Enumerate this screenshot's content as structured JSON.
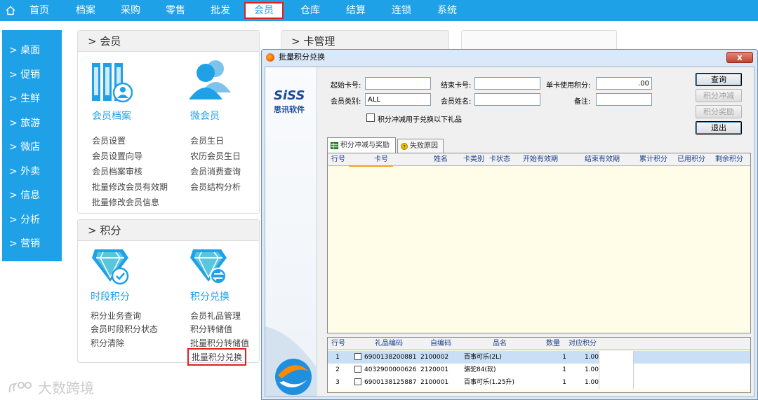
{
  "topnav": {
    "items": [
      "首页",
      "档案",
      "采购",
      "零售",
      "批发",
      "会员",
      "仓库",
      "结算",
      "连锁",
      "系统"
    ],
    "active": "会员"
  },
  "sidebar": {
    "items": [
      "> 桌面",
      "> 促销",
      "> 生鲜",
      "> 旅游",
      "> 微店",
      "> 外卖",
      "> 信息",
      "> 分析",
      "> 营销"
    ]
  },
  "panels": {
    "member": {
      "title": "> 会员",
      "card1": "会员档案",
      "card2": "微会员",
      "links_left": [
        "会员设置",
        "会员设置向导",
        "会员档案审核",
        "批量修改会员有效期",
        "批量修改会员信息"
      ],
      "links_right": [
        "会员生日",
        "农历会员生日",
        "会员消费查询",
        "会员结构分析"
      ]
    },
    "card": {
      "title": "> 卡管理"
    },
    "points": {
      "title": "> 积分",
      "card1": "时段积分",
      "card2": "积分兑换",
      "links_left": [
        "积分业务查询",
        "会员时段积分状态",
        "积分清除"
      ],
      "links_right": [
        "会员礼品管理",
        "积分转储值",
        "批量积分转储值",
        "批量积分兑换"
      ]
    }
  },
  "watermark": "大数跨境",
  "dialog": {
    "title": "批量积分兑换",
    "close": "x",
    "logo": {
      "brand": "SiSS",
      "sub": "思讯软件"
    },
    "form": {
      "start_card_label": "起始卡号:",
      "start_card_value": "",
      "end_card_label": "结束卡号:",
      "end_card_value": "",
      "single_points_label": "单卡使用积分:",
      "single_points_value": ".00",
      "member_type_label": "会员类别:",
      "member_type_value": "ALL",
      "member_name_label": "会员姓名:",
      "member_name_value": "",
      "remark_label": "备注:",
      "remark_value": "",
      "offset_checkbox_label": "积分冲减用于兑换以下礼品"
    },
    "buttons": {
      "query": "查询",
      "offset": "积分冲减",
      "reward": "积分奖励",
      "exit": "退出"
    },
    "tabs": [
      "积分冲减与奖励",
      "失败原因"
    ],
    "main_grid": {
      "headers": [
        "行号",
        "卡号",
        "姓名",
        "卡类别",
        "卡状态",
        "开始有效期",
        "结束有效期",
        "累计积分",
        "已用积分",
        "剩余积分"
      ]
    },
    "gift_grid": {
      "headers": [
        "行号",
        "礼品编码",
        "自编码",
        "品名",
        "数量",
        "对应积分"
      ],
      "rows": [
        {
          "no": "1",
          "code": "6900138200881",
          "self": "2100002",
          "name": "百事可乐(2L)",
          "qty": "1",
          "points": "1.00"
        },
        {
          "no": "2",
          "code": "4032900000626",
          "self": "2120001",
          "name": "骆驼84(软)",
          "qty": "1",
          "points": "1.00"
        },
        {
          "no": "3",
          "code": "6900138125887",
          "self": "2100001",
          "name": "百事可乐(1.25升)",
          "qty": "1",
          "points": "1.00"
        }
      ]
    }
  }
}
